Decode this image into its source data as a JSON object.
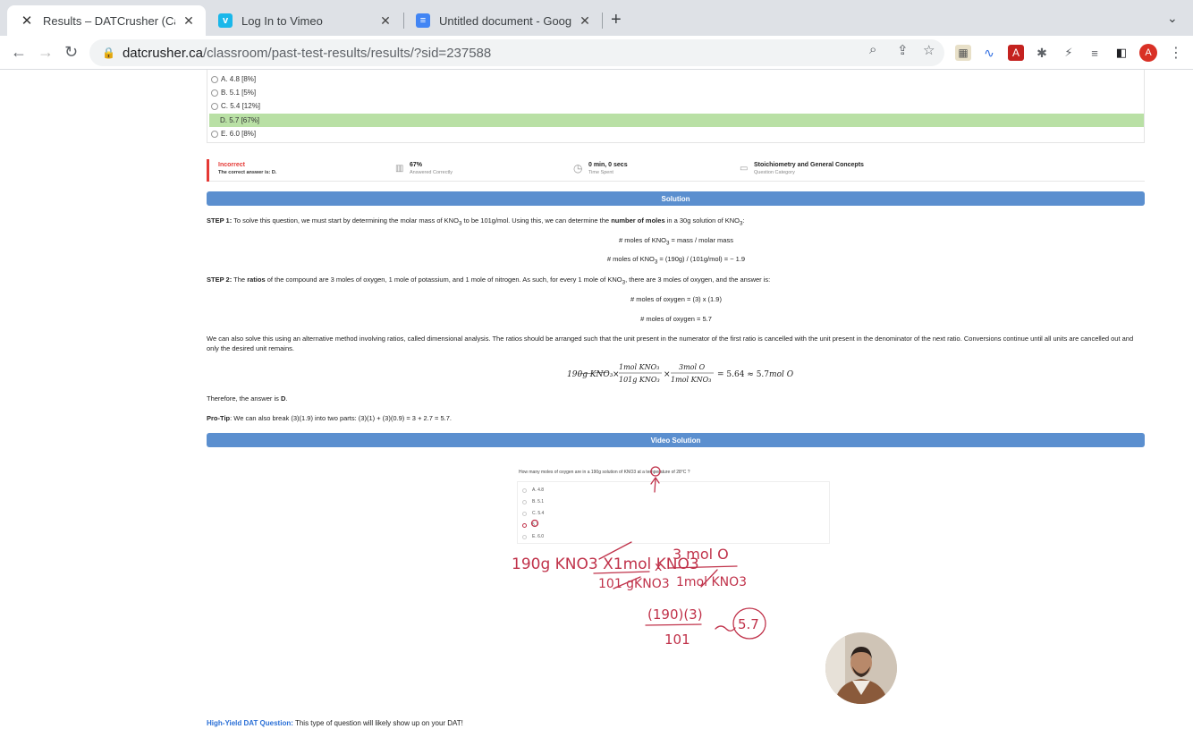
{
  "browser": {
    "tabs": [
      {
        "title": "Results – DATCrusher (Canadia",
        "favicon": "X"
      },
      {
        "title": "Log In to Vimeo",
        "favicon": "v"
      },
      {
        "title": "Untitled document - Google Do",
        "favicon": "≡"
      }
    ],
    "url_domain": "datcrusher.ca",
    "url_path": "/classroom/past-test-results/results/?sid=237588",
    "profile_initial": "A"
  },
  "options": [
    {
      "label": "A. 4.8 [8%]",
      "correct": false
    },
    {
      "label": "B. 5.1 [5%]",
      "correct": false
    },
    {
      "label": "C. 5.4 [12%]",
      "correct": false
    },
    {
      "label": "D. 5.7 [67%]",
      "correct": true
    },
    {
      "label": "E. 6.0 [8%]",
      "correct": false
    }
  ],
  "result": {
    "status": "Incorrect",
    "correct_answer": "The correct answer is: D.",
    "percent": "67%",
    "percent_label": "Answered Correctly",
    "time": "0 min, 0 secs",
    "time_label": "Time Spent",
    "category": "Stoichiometry and General Concepts",
    "category_label": "Question Category"
  },
  "solution": {
    "header": "Solution",
    "step1_label": "STEP 1:",
    "step1_a": " To solve this question, we must start by determining the molar mass of KNO",
    "step1_b": " to be 101g/mol. Using this, we can determine the ",
    "step1_bold": "number of moles",
    "step1_c": " in a 30g solution of KNO",
    "step1_d": ":",
    "eq1_a": "# moles of KNO",
    "eq1_b": " = mass / molar mass",
    "eq2_a": "# moles of KNO",
    "eq2_b": " = (190g) / (101g/mol) = ~ 1.9",
    "step2_label": "STEP 2:",
    "step2_a": " The ",
    "step2_bold": "ratios",
    "step2_b": " of the compound are 3 moles of oxygen, 1 mole of potassium, and 1 mole of nitrogen. As such, for every 1 mole of KNO",
    "step2_c": ", there are 3 moles of oxygen, and the answer is:",
    "eq3": "# moles of oxygen = (3) x (1.9)",
    "eq4": "# moles of oxygen = 5.7",
    "alt": "We can also solve this using an alternative method involving ratios, called dimensional analysis. The ratios should be arranged such that the unit present in the numerator of the first ratio is cancelled with the unit present in the denominator of the next ratio. Conversions continue until all units are cancelled out and only the desired unit remains.",
    "therefore_a": "Therefore, the answer is ",
    "therefore_b": "D",
    "therefore_c": ".",
    "protip_label": "Pro-Tip",
    "protip": ": We can also break (3)(1.9) into two parts: (3)(1) + (3)(0.9) =  3 + 2.7 = 5.7.",
    "subscript_3": "3"
  },
  "video": {
    "header": "Video Solution",
    "question": "How many moles of oxygen are in a 190g solution of KNO3 at a temperature of 28°C ?",
    "options": [
      "A. 4.8",
      "B. 5.1",
      "C. 5.4",
      "5.7",
      "E. 6.0"
    ]
  },
  "footer": {
    "label": "High-Yield DAT Question:",
    "text": " This type of question will likely show up on your DAT!"
  }
}
